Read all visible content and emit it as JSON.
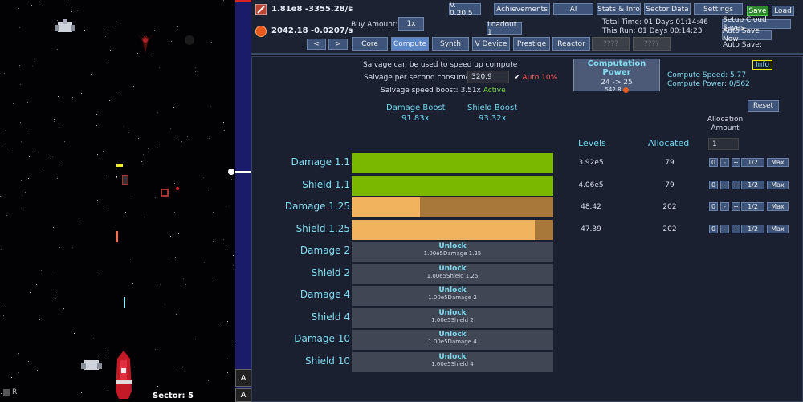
{
  "game": {
    "sector_label": "Sector: 5",
    "ri_label": "RI"
  },
  "side_buttons": [
    "A",
    "A"
  ],
  "resources": {
    "primary": {
      "value": "1.81e8",
      "rate": "-3355.28/s"
    },
    "secondary": {
      "value": "2042.18",
      "rate": "-0.0207/s"
    }
  },
  "buy": {
    "label": "Buy Amount:",
    "value": "1x"
  },
  "version": "V. 0.20.5",
  "loadout": "Loadout 1",
  "top_buttons": {
    "achievements": "Achievements",
    "ai": "AI",
    "stats": "Stats & Info",
    "sector": "Sector Data",
    "settings": "Settings",
    "save": "Save",
    "load": "Load",
    "cloud": "Setup Cloud Saves",
    "autosave_now": "Auto Save Now"
  },
  "times": {
    "total": "Total Time: 01 Days 01:14:46",
    "run": "This Run: 01 Days 00:14:23",
    "autosave": "Auto Save:"
  },
  "nav": {
    "prev": "<",
    "next": ">",
    "tabs": [
      "Core",
      "Compute",
      "Synth",
      "V Device",
      "Prestige",
      "Reactor",
      "????",
      "????"
    ]
  },
  "compute": {
    "salvage_info": "Salvage can be used to speed up compute",
    "salvage_label": "Salvage per second consumed:",
    "salvage_value": "320.9",
    "auto_label": "Auto 10%",
    "boost_label": "Salvage speed boost: 3.51x",
    "boost_status": "Active",
    "power_title": "Computation Power",
    "power_range": "24 -> 25",
    "power_cost": "542.8",
    "speed": "Compute Speed: 5.77",
    "power": "Compute Power: 0/562",
    "info": "Info",
    "damage_boost_label": "Damage Boost",
    "damage_boost_value": "91.83x",
    "shield_boost_label": "Shield Boost",
    "shield_boost_value": "93.32x",
    "reset": "Reset",
    "alloc_header": "Allocation Amount",
    "alloc_value": "1",
    "levels_header": "Levels",
    "allocated_header": "Allocated",
    "colors": {
      "green": "#7ab800",
      "orange": "#f2b35e",
      "orange_bg": "#a8773a"
    },
    "rows": [
      {
        "name": "Damage 1.1",
        "level": "3.92e5",
        "allocated": "79",
        "progress": 1.0,
        "color": "green",
        "locked": false
      },
      {
        "name": "Shield 1.1",
        "level": "4.06e5",
        "allocated": "79",
        "progress": 1.0,
        "color": "green",
        "locked": false
      },
      {
        "name": "Damage 1.25",
        "level": "48.42",
        "allocated": "202",
        "progress": 0.34,
        "color": "orange",
        "locked": false
      },
      {
        "name": "Shield 1.25",
        "level": "47.39",
        "allocated": "202",
        "progress": 0.91,
        "color": "orange",
        "locked": false
      },
      {
        "name": "Damage 2",
        "locked": true,
        "unlock": "Unlock",
        "cost": "1.00e5Damage 1.25"
      },
      {
        "name": "Shield 2",
        "locked": true,
        "unlock": "Unlock",
        "cost": "1.00e5Shield 1.25"
      },
      {
        "name": "Damage 4",
        "locked": true,
        "unlock": "Unlock",
        "cost": "1.00e5Damage 2"
      },
      {
        "name": "Shield 4",
        "locked": true,
        "unlock": "Unlock",
        "cost": "1.00e5Shield 2"
      },
      {
        "name": "Damage 10",
        "locked": true,
        "unlock": "Unlock",
        "cost": "1.00e5Damage 4"
      },
      {
        "name": "Shield 10",
        "locked": true,
        "unlock": "Unlock",
        "cost": "1.00e5Shield 4"
      }
    ],
    "row_buttons": [
      "0",
      "-",
      "+",
      "1/2",
      "Max"
    ]
  }
}
